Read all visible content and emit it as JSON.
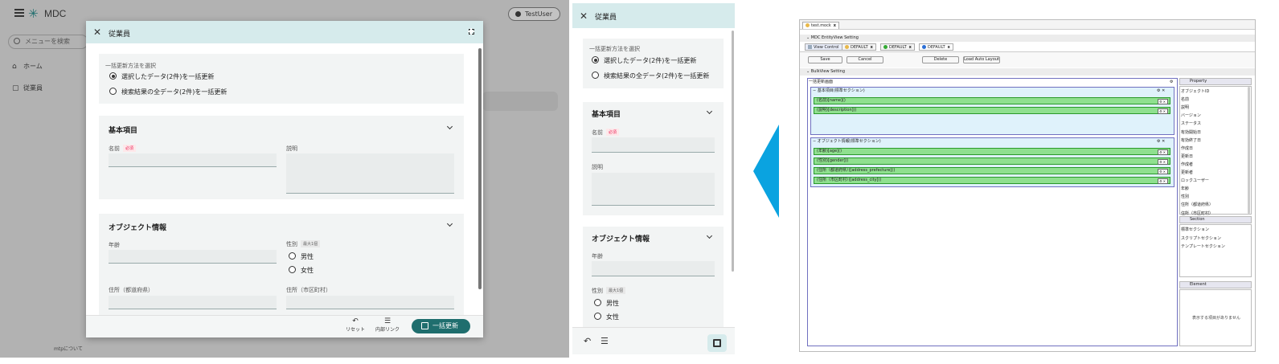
{
  "desktop": {
    "app_title": "MDC",
    "user": "TestUser",
    "search_placeholder": "メニューを検索",
    "nav": [
      {
        "label": "ホーム"
      },
      {
        "label": "従業員"
      }
    ],
    "footer_link": "mtpについて",
    "modal": {
      "title": "従業員",
      "update_method": {
        "label": "一括更新方法を選択",
        "options": [
          "選択したデータ(2件)を一括更新",
          "検索結果の全データ(2件)を一括更新"
        ],
        "selected_index": 0
      },
      "basic_section": {
        "title": "基本項目",
        "name_label": "名前",
        "required_tag": "必須",
        "description_label": "説明"
      },
      "object_section": {
        "title": "オブジェクト情報",
        "age_label": "年齢",
        "gender_label": "性別",
        "gender_tag": "最大1個",
        "gender_options": [
          "男性",
          "女性"
        ],
        "prefecture_label": "住所（都道府県）",
        "city_label": "住所（市区町村）"
      },
      "footer": {
        "reset_label": "リセット",
        "link_label": "内部リンク",
        "submit_label": "一括更新"
      }
    }
  },
  "mobile": {
    "title": "従業員",
    "update_method": {
      "label": "一括更新方法を選択",
      "options": [
        "選択したデータ(2件)を一括更新",
        "検索結果の全データ(2件)を一括更新"
      ]
    },
    "basic_section": {
      "title": "基本項目",
      "name_label": "名前",
      "required_tag": "必須",
      "description_label": "説明"
    },
    "object_section": {
      "title": "オブジェクト情報",
      "age_label": "年齢",
      "gender_label": "性別",
      "gender_tag": "最大1個",
      "gender_options": [
        "男性",
        "女性"
      ]
    }
  },
  "editor": {
    "file_tab": "test.mock",
    "setting_header": "MDC EntityView Setting",
    "tabs": [
      "View Control",
      "DEFAULT",
      "DEFAULT",
      "DEFAULT"
    ],
    "buttons": {
      "save": "Save",
      "cancel": "Cancel",
      "delete": "Delete",
      "load_auto_layout": "Load Auto Layout"
    },
    "bulkview_header": "BulkView Setting",
    "screen_title": "一括更新画面",
    "section1": {
      "title": "基本項目(標準セクション)",
      "fields": [
        "(名前)[name]()",
        "(説明)[description]()"
      ]
    },
    "section2": {
      "title": "オブジェクト情報(標準セクション)",
      "fields": [
        "(年齢)[age]()",
        "(性別)[gender]()",
        "(住所（都道府県）)[address_prefecture]()",
        "(住所（市区町村）)[address_city]()"
      ]
    },
    "property": {
      "title": "Property",
      "items": [
        "オブジェクトID",
        "名前",
        "説明",
        "バージョン",
        "ステータス",
        "有効開始日",
        "有効終了日",
        "作成日",
        "更新日",
        "作成者",
        "更新者",
        "ロックユーザー",
        "年齢",
        "性別",
        "住所（都道府県）",
        "住所（市区町村）"
      ]
    },
    "section_pane": {
      "title": "Section",
      "items": [
        "標準セクション",
        "スクリプトセクション",
        "テンプレートセクション"
      ]
    },
    "element_pane": {
      "title": "Element",
      "empty": "表示する項目がありません"
    },
    "colors": {
      "field_green": "#8fe08f",
      "border_purple": "#7070c0"
    }
  },
  "colors": {
    "primary": "#1f6e6e",
    "header_tint": "#d6ebec",
    "arrow": "#0aa3e0",
    "required": "#e22255"
  }
}
